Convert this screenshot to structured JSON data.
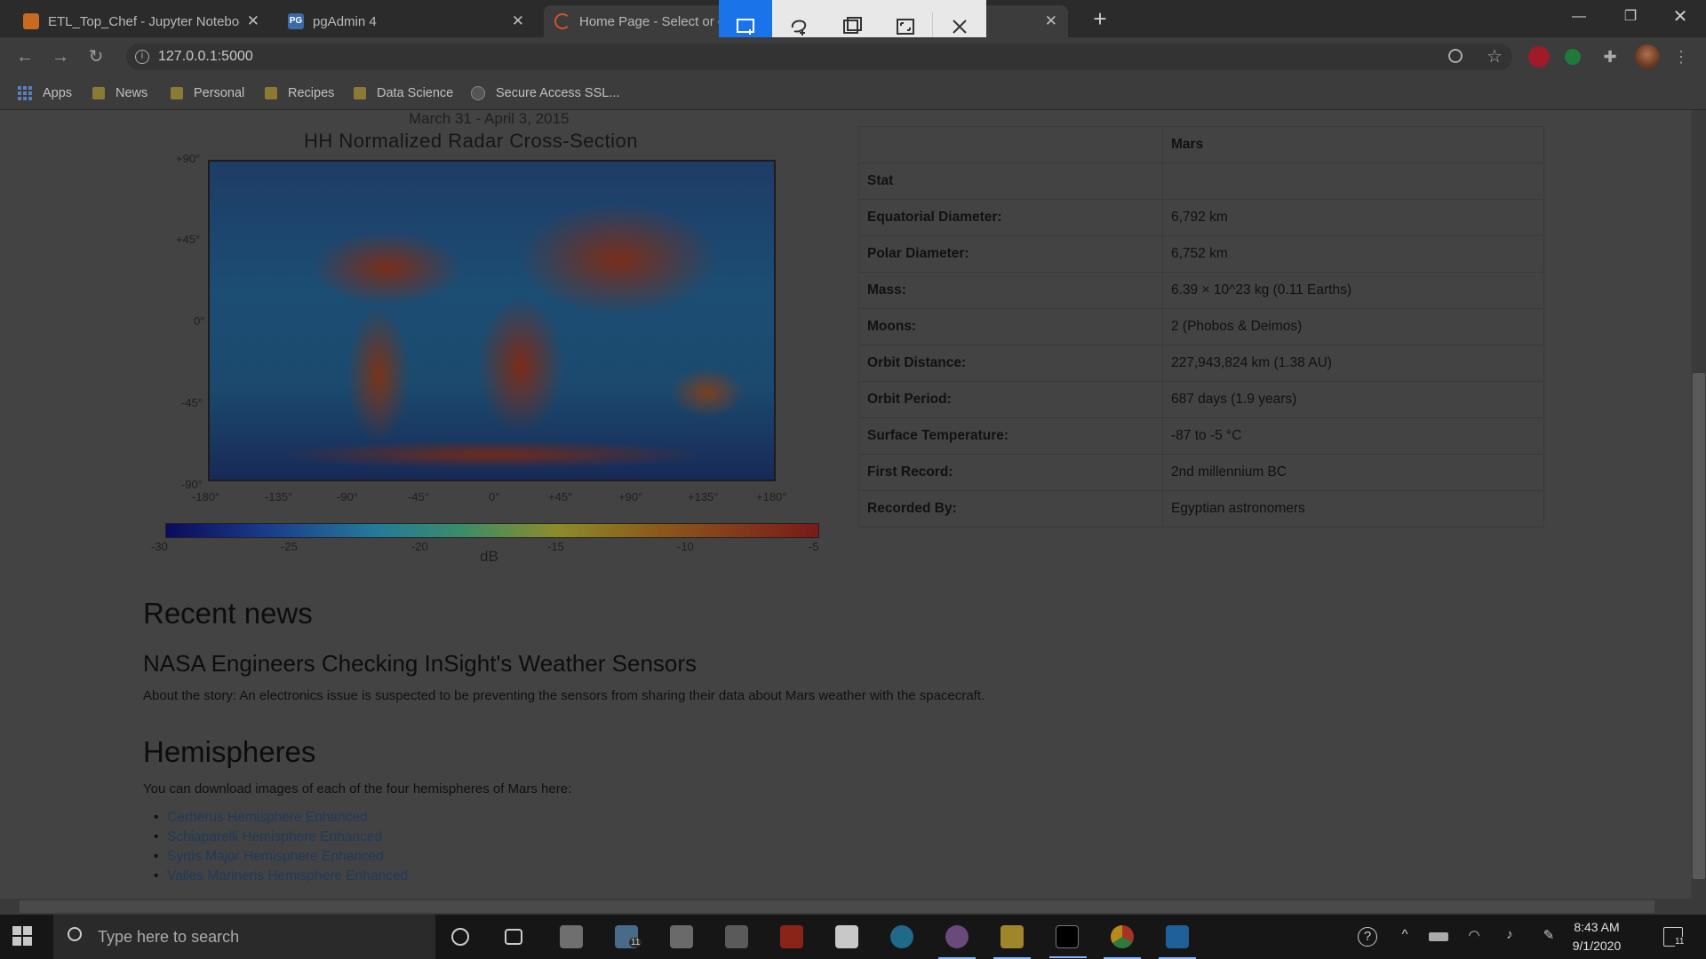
{
  "browser": {
    "tabs": [
      {
        "title": "ETL_Top_Chef - Jupyter Noteboo",
        "favicon_color": "#c86b1e"
      },
      {
        "title": "pgAdmin 4",
        "favicon_color": "#3a6aa8",
        "favicon_text": "PG"
      },
      {
        "title": "Home Page - Select or c",
        "favicon_color": "#d0542a"
      }
    ],
    "address": "127.0.0.1:5000",
    "bookmarks": [
      "Apps",
      "News",
      "Personal",
      "Recipes",
      "Data Science",
      "Secure Access SSL..."
    ]
  },
  "snip_toolbar": {
    "tools": [
      "rectangular-snip-icon",
      "freeform-snip-icon",
      "window-snip-icon",
      "fullscreen-snip-icon",
      "close-icon"
    ]
  },
  "page": {
    "map": {
      "subtitle": "March 31 - April 3, 2015",
      "title": "HH Normalized Radar Cross-Section",
      "lat_labels": [
        "+90°",
        "+45°",
        "0°",
        "-45°",
        "-90°"
      ],
      "lon_labels": [
        "-180°",
        "-135°",
        "-90°",
        "-45°",
        "0°",
        "+45°",
        "+90°",
        "+135°",
        "+180°"
      ],
      "colorbar_ticks": [
        "-30",
        "-25",
        "-20",
        "-15",
        "-10",
        "-5"
      ],
      "colorbar_unit": "dB"
    },
    "facts_table": {
      "header": "Mars",
      "stat_label": "Stat",
      "rows": [
        {
          "key": "Equatorial Diameter:",
          "value": "6,792 km"
        },
        {
          "key": "Polar Diameter:",
          "value": "6,752 km"
        },
        {
          "key": "Mass:",
          "value": "6.39 × 10^23 kg (0.11 Earths)"
        },
        {
          "key": "Moons:",
          "value": "2 (Phobos & Deimos)"
        },
        {
          "key": "Orbit Distance:",
          "value": "227,943,824 km (1.38 AU)"
        },
        {
          "key": "Orbit Period:",
          "value": "687 days (1.9 years)"
        },
        {
          "key": "Surface Temperature:",
          "value": "-87 to -5 °C"
        },
        {
          "key": "First Record:",
          "value": "2nd millennium BC"
        },
        {
          "key": "Recorded By:",
          "value": "Egyptian astronomers"
        }
      ]
    },
    "news": {
      "heading": "Recent news",
      "title": "NASA Engineers Checking InSight's Weather Sensors",
      "teaser": "About the story: An electronics issue is suspected to be preventing the sensors from sharing their data about Mars weather with the spacecraft."
    },
    "hemispheres": {
      "heading": "Hemispheres",
      "intro": "You can download images of each of the four hemispheres of Mars here:",
      "links": [
        "Cerberus Hemisphere Enhanced",
        "Schiaparelli Hemisphere Enhanced",
        "Syrtis Major Hemisphere Enhanced",
        "Valles Marineris Hemisphere Enhanced"
      ]
    }
  },
  "taskbar": {
    "search_placeholder": "Type here to search",
    "time": "8:43 AM",
    "date": "9/1/2020",
    "mail_badge": "11",
    "notification_badge": "11"
  }
}
